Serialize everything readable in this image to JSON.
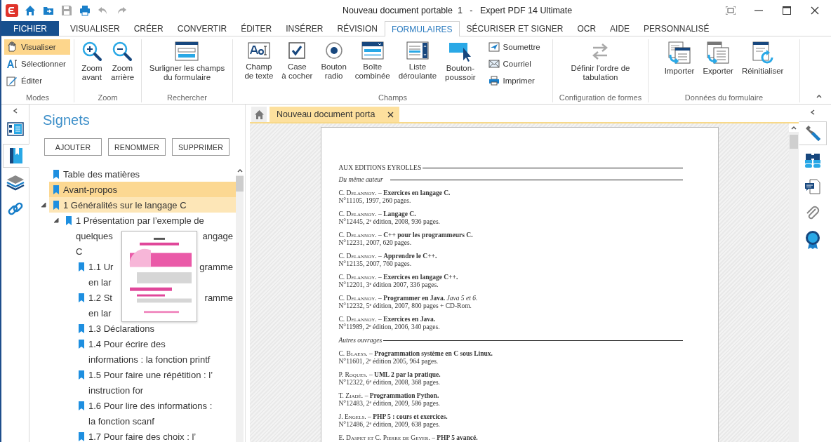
{
  "window": {
    "title": "Nouveau document portable  1   -   Expert PDF 14 Ultimate"
  },
  "quick_access": [
    {
      "disabled": false
    },
    {
      "disabled": false
    },
    {
      "disabled": true
    },
    {
      "disabled": false
    },
    {
      "disabled": true
    },
    {
      "disabled": true
    }
  ],
  "menu_tabs": [
    {
      "label": "FICHIER",
      "kind": "file",
      "selected": false
    },
    {
      "label": "VISUALISER",
      "kind": "tab",
      "selected": false
    },
    {
      "label": "CRÉER",
      "kind": "tab",
      "selected": false
    },
    {
      "label": "CONVERTIR",
      "kind": "tab",
      "selected": false
    },
    {
      "label": "ÉDITER",
      "kind": "tab",
      "selected": false
    },
    {
      "label": "INSÉRER",
      "kind": "tab",
      "selected": false
    },
    {
      "label": "RÉVISION",
      "kind": "tab",
      "selected": false
    },
    {
      "label": "FORMULAIRES",
      "kind": "tab",
      "selected": true
    },
    {
      "label": "SÉCURISER ET SIGNER",
      "kind": "tab",
      "selected": false
    },
    {
      "label": "OCR",
      "kind": "tab",
      "selected": false
    },
    {
      "label": "AIDE",
      "kind": "tab",
      "selected": false
    },
    {
      "label": "PERSONNALISÉ",
      "kind": "tab",
      "selected": false
    }
  ],
  "ribbon": {
    "groups": [
      {
        "label": "Modes",
        "items": [
          {
            "kind": "small",
            "label": "Visualiser",
            "selected": true
          },
          {
            "kind": "small",
            "label": "Sélectionner",
            "selected": false
          },
          {
            "kind": "small",
            "label": "Éditer",
            "selected": false
          }
        ]
      },
      {
        "label": "Zoom",
        "items": [
          {
            "kind": "large",
            "label": "Zoom\navant"
          },
          {
            "kind": "large",
            "label": "Zoom\narrière"
          }
        ]
      },
      {
        "label": "Rechercher",
        "items": [
          {
            "kind": "large",
            "label": "Surligner les champs\ndu formulaire"
          }
        ]
      },
      {
        "label": "Champs",
        "items": [
          {
            "kind": "large",
            "label": "Champ\nde texte"
          },
          {
            "kind": "large",
            "label": "Case\nà cocher"
          },
          {
            "kind": "large",
            "label": "Bouton\nradio"
          },
          {
            "kind": "large",
            "label": "Boîte\ncombinée"
          },
          {
            "kind": "large",
            "label": "Liste\ndéroulante"
          },
          {
            "kind": "large",
            "label": "Bouton-\npoussoir"
          },
          {
            "kind": "small",
            "label": "Soumettre",
            "selected": false
          },
          {
            "kind": "small",
            "label": "Courriel",
            "selected": false
          },
          {
            "kind": "small",
            "label": "Imprimer",
            "selected": false
          }
        ]
      },
      {
        "label": "Configuration de formes",
        "items": [
          {
            "kind": "large",
            "label": "Définir l'ordre de\ntabulation"
          }
        ]
      },
      {
        "label": "Données du formulaire",
        "items": [
          {
            "kind": "large",
            "label": "Importer"
          },
          {
            "kind": "large",
            "label": "Exporter"
          },
          {
            "kind": "large",
            "label": "Réinitialiser"
          }
        ]
      }
    ]
  },
  "left_tabs": [
    {
      "selected": false
    },
    {
      "selected": true
    },
    {
      "selected": false
    },
    {
      "selected": false
    }
  ],
  "bookmarks": {
    "title": "Signets",
    "buttons": [
      "AJOUTER",
      "RENOMMER",
      "SUPPRIMER"
    ],
    "items": [
      {
        "lines": [
          [
            "Table des matières"
          ]
        ],
        "selected": false,
        "hovered": false
      },
      {
        "lines": [
          [
            "Avant-propos"
          ]
        ],
        "selected": true,
        "hovered": false
      },
      {
        "lines": [
          [
            "1 Généralités sur le langage C"
          ]
        ],
        "selected": false,
        "hovered": true,
        "expanded": true,
        "children": [
          {
            "lines": [
              [
                "1 Présentation par l’exemple de"
              ],
              [
                "quelques",
                "angage"
              ],
              [
                "C"
              ]
            ],
            "selected": false,
            "hovered": false,
            "expanded": true,
            "children": [
              {
                "lines": [
                  [
                    "1.1 Ur",
                    "gramme"
                  ],
                  [
                    "en lar"
                  ]
                ],
                "selected": false,
                "hovered": false
              },
              {
                "lines": [
                  [
                    "1.2 St",
                    "ramme"
                  ],
                  [
                    "en lar"
                  ]
                ],
                "selected": false,
                "hovered": false
              },
              {
                "lines": [
                  [
                    "1.3 Déclarations"
                  ]
                ],
                "selected": false,
                "hovered": false
              },
              {
                "lines": [
                  [
                    "1.4 Pour écrire des"
                  ],
                  [
                    "informations : la fonction printf"
                  ]
                ],
                "selected": false,
                "hovered": false
              },
              {
                "lines": [
                  [
                    "1.5 Pour faire une répétition : l’"
                  ],
                  [
                    "instruction for"
                  ]
                ],
                "selected": false,
                "hovered": false
              },
              {
                "lines": [
                  [
                    "1.6 Pour lire des informations :"
                  ],
                  [
                    "la fonction scanf"
                  ]
                ],
                "selected": false,
                "hovered": false
              },
              {
                "lines": [
                  [
                    "1.7 Pour faire des choix : l’"
                  ]
                ],
                "selected": false,
                "hovered": false
              }
            ]
          }
        ]
      }
    ]
  },
  "doc_tabs": [
    {
      "label": "Nouveau document porta",
      "selected": true
    }
  ],
  "document": {
    "heading": "AUX EDITIONS EYROLLES",
    "sections": [
      {
        "title": "Du même auteur",
        "entries": [
          {
            "author": "C. Delannoy.",
            "title": "– **Exercices en langage C.**",
            "details": "N°11105, 1997, 260 pages."
          },
          {
            "author": "C. Delannoy.",
            "title": "– **Langage C.**",
            "details": "N°12445, 2$^{e}$ édition, 2008, 936 pages."
          },
          {
            "author": "C. Delannoy.",
            "title": "– **C++ pour les programmeurs C.**",
            "details": "N°12231, 2007, 620 pages."
          },
          {
            "author": "C. Delannoy.",
            "title": "– **Apprendre le C++.**",
            "details": "N°12135, 2007, 760 pages."
          },
          {
            "author": "C. Delannoy.",
            "title": "– **Exercices en langage C++.**",
            "details": "N°12201, 3$^{e}$ édition 2007, 336 pages."
          },
          {
            "author": "C. Delannoy.",
            "title": "– **Programmer en Java.** *Java 5 et 6.*",
            "details": "N°12232, 5$^{e}$ édition, 2007, 800 pages + CD-Rom."
          },
          {
            "author": "C. Delannoy.",
            "title": "– **Exercices en Java.**",
            "details": "N°11989, 2$^{e}$ édition, 2006, 340 pages."
          }
        ]
      },
      {
        "title": "Autres ouvrages",
        "entries": [
          {
            "author": "C. Blaess.",
            "title": "– **Programmation système en C sous Linux.**",
            "details": "N°11601, 2$^{e}$ édition 2005, 964 pages."
          },
          {
            "author": "P. Roques.",
            "title": "– **UML 2 par la pratique.**",
            "details": "N°12322, 6$^{e}$ édition, 2008, 368 pages."
          },
          {
            "author": "T. Ziadé.",
            "title": "– **Programmation Python.**",
            "details": "N°12483, 2$^{e}$ édition, 2009, 586 pages."
          },
          {
            "author": "J. Engels.",
            "title": "– **PHP 5 : cours et exercices.**",
            "details": "N°12486, 2$^{e}$ édition, 2009, 638 pages."
          },
          {
            "author": "E. Daspet et C. Pierre  de Geyer.",
            "title": "– **PHP 5 avancé.**"
          }
        ]
      }
    ]
  },
  "right_tabs": [
    {
      "selected": true
    },
    {
      "selected": false
    },
    {
      "selected": false
    },
    {
      "selected": false
    },
    {
      "selected": false
    }
  ]
}
